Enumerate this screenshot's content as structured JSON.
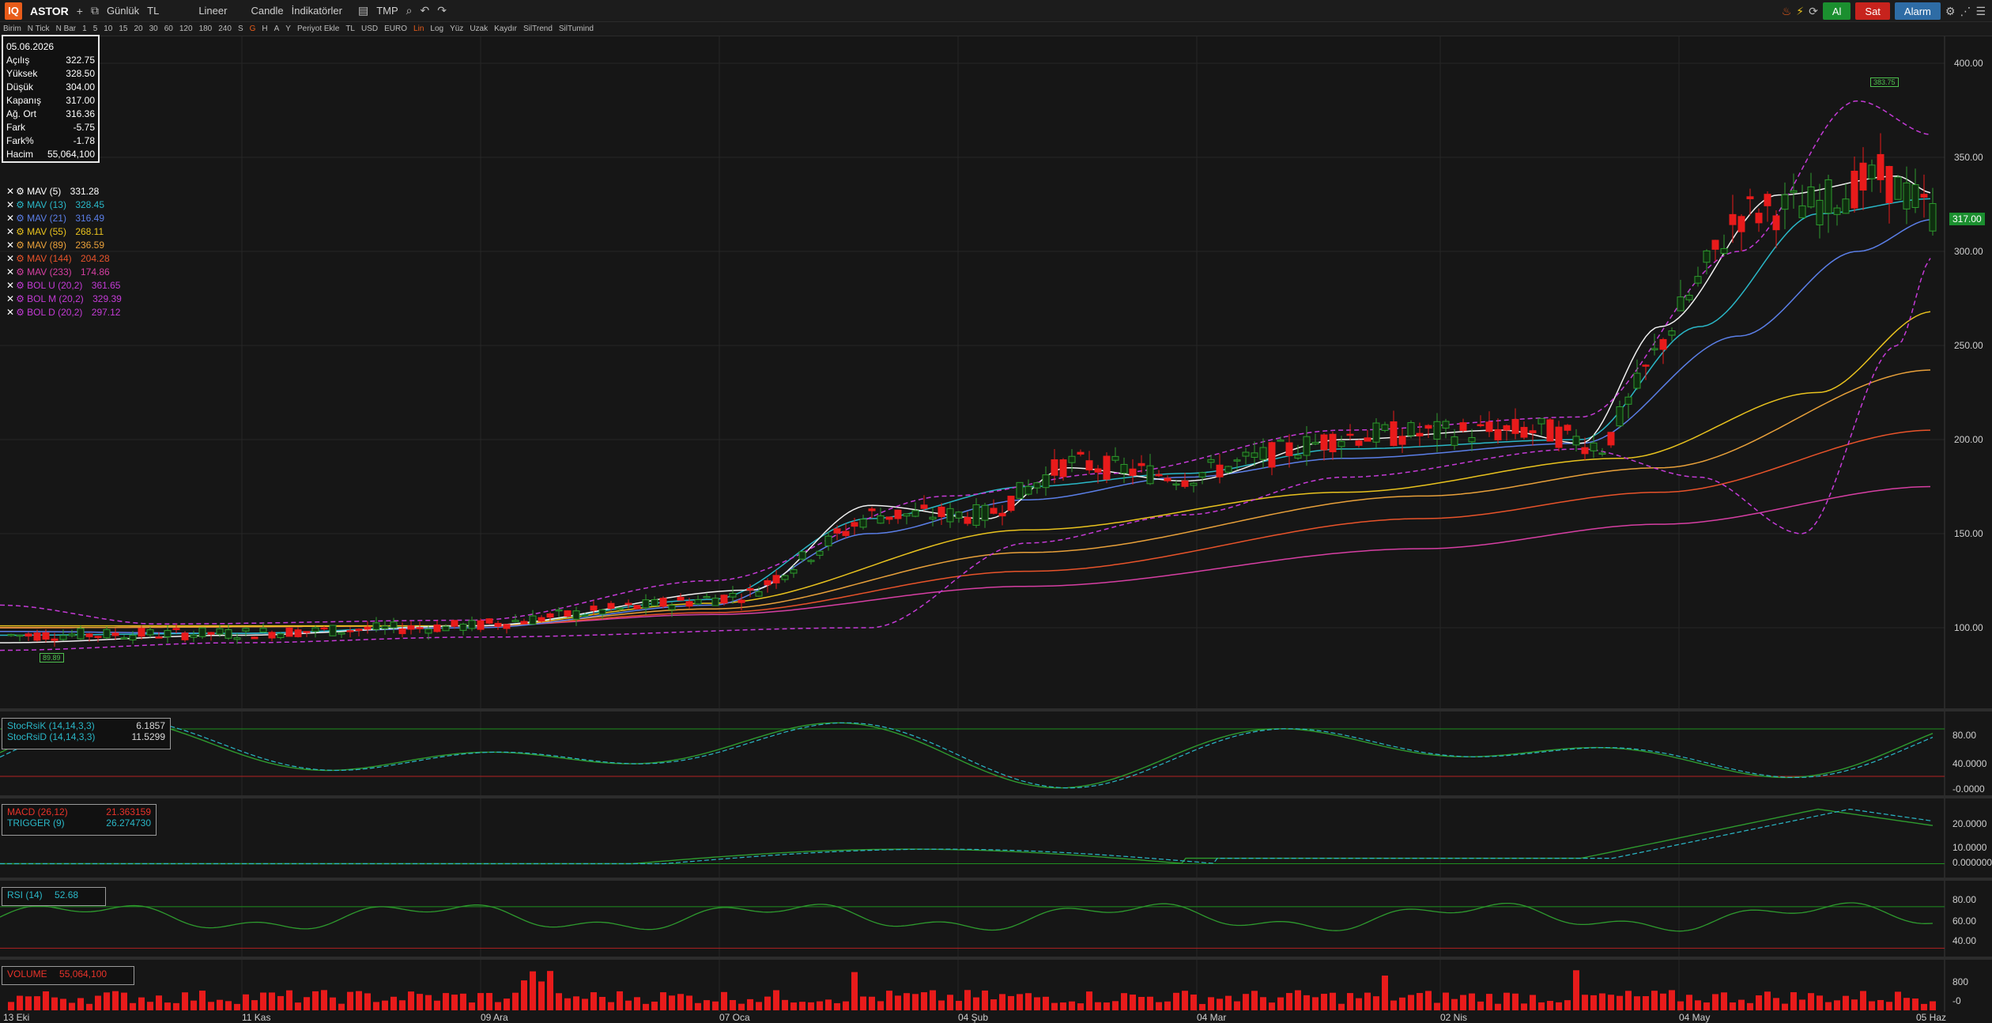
{
  "toolbar": {
    "logo": "IQ",
    "symbol": "ASTOR",
    "add": "+",
    "period": "Günlük",
    "currency": "TL",
    "scale": "Lineer",
    "chart_type": "Candle",
    "indicators": "İndikatörler",
    "template": "TMP",
    "buy": "Al",
    "sell": "Sat",
    "alarm": "Alarm"
  },
  "toolbar2": {
    "items": [
      "Birim",
      "N Tick",
      "N Bar",
      "1",
      "5",
      "10",
      "15",
      "20",
      "30",
      "60",
      "120",
      "180",
      "240",
      "S",
      "G",
      "H",
      "A",
      "Y",
      "Periyot Ekle",
      "TL",
      "USD",
      "EURO",
      "Lin",
      "Log",
      "Yüz",
      "Uzak",
      "Kaydır",
      "SilTrend",
      "SilTumind"
    ]
  },
  "info": {
    "date": "05.06.2026",
    "rows": [
      {
        "label": "Açılış",
        "value": "322.75"
      },
      {
        "label": "Yüksek",
        "value": "328.50"
      },
      {
        "label": "Düşük",
        "value": "304.00"
      },
      {
        "label": "Kapanış",
        "value": "317.00"
      },
      {
        "label": "Ağ. Ort",
        "value": "316.36"
      },
      {
        "label": "Fark",
        "value": "-5.75"
      },
      {
        "label": "Fark%",
        "value": "-1.78"
      },
      {
        "label": "Hacim",
        "value": "55,064,100"
      }
    ]
  },
  "indicators": [
    {
      "label": "MAV (5)",
      "value": "331.28",
      "color": "#ffffff"
    },
    {
      "label": "MAV (13)",
      "value": "328.45",
      "color": "#2ab7c7"
    },
    {
      "label": "MAV (21)",
      "value": "316.49",
      "color": "#5b7fe8"
    },
    {
      "label": "MAV (55)",
      "value": "268.11",
      "color": "#e8c21e"
    },
    {
      "label": "MAV (89)",
      "value": "236.59",
      "color": "#e8a03a"
    },
    {
      "label": "MAV (144)",
      "value": "204.28",
      "color": "#e8532a"
    },
    {
      "label": "MAV (233)",
      "value": "174.86",
      "color": "#d63fa3"
    },
    {
      "label": "BOL U (20,2)",
      "value": "361.65",
      "color": "#c43ad6"
    },
    {
      "label": "BOL M (20,2)",
      "value": "329.39",
      "color": "#c43ad6"
    },
    {
      "label": "BOL D (20,2)",
      "value": "297.12",
      "color": "#c43ad6"
    }
  ],
  "price_axis": [
    "400.00",
    "350.00",
    "300.00",
    "250.00",
    "200.00",
    "150.00",
    "100.00"
  ],
  "last_price": "317.00",
  "high_marker": "383.75",
  "low_marker": "89.89",
  "stoch": {
    "k_label": "StocRsiK (14,14,3,3)",
    "k_value": "6.1857",
    "d_label": "StocRsiD (14,14,3,3)",
    "d_value": "11.5299",
    "axis": [
      "80.00",
      "40.0000",
      "-0.0000"
    ]
  },
  "macd": {
    "macd_label": "MACD (26,12)",
    "macd_value": "21.363159",
    "trigger_label": "TRIGGER (9)",
    "trigger_value": "26.274730",
    "axis": [
      "20.0000",
      "10.0000",
      "0.000000"
    ]
  },
  "rsi": {
    "label": "RSI (14)",
    "value": "52.68",
    "axis": [
      "80.00",
      "60.00",
      "40.00"
    ]
  },
  "volume": {
    "label": "VOLUME",
    "value": "55,064,100",
    "axis": [
      "800",
      "-0"
    ]
  },
  "x_axis": [
    "13 Eki",
    "11 Kas",
    "09 Ara",
    "07 Oca",
    "04 Şub",
    "04 Mar",
    "02 Nis",
    "04 May",
    "05 Haz"
  ],
  "chart_data": {
    "type": "line",
    "title": "",
    "ylim": [
      60,
      420
    ],
    "x": [
      "13 Eki",
      "11 Kas",
      "09 Ara",
      "07 Oca",
      "04 Şub",
      "04 Mar",
      "02 Nis",
      "04 May",
      "05 Haz"
    ],
    "series": [
      {
        "name": "MAV (5)",
        "values": [
          90,
          96,
          100,
          118,
          160,
          180,
          205,
          320,
          331
        ]
      },
      {
        "name": "MAV (55)",
        "values": [
          100,
          98,
          99,
          105,
          128,
          158,
          175,
          205,
          268
        ]
      },
      {
        "name": "MAV (233)",
        "values": [
          100,
          102,
          104,
          110,
          124,
          135,
          145,
          160,
          175
        ]
      }
    ]
  }
}
